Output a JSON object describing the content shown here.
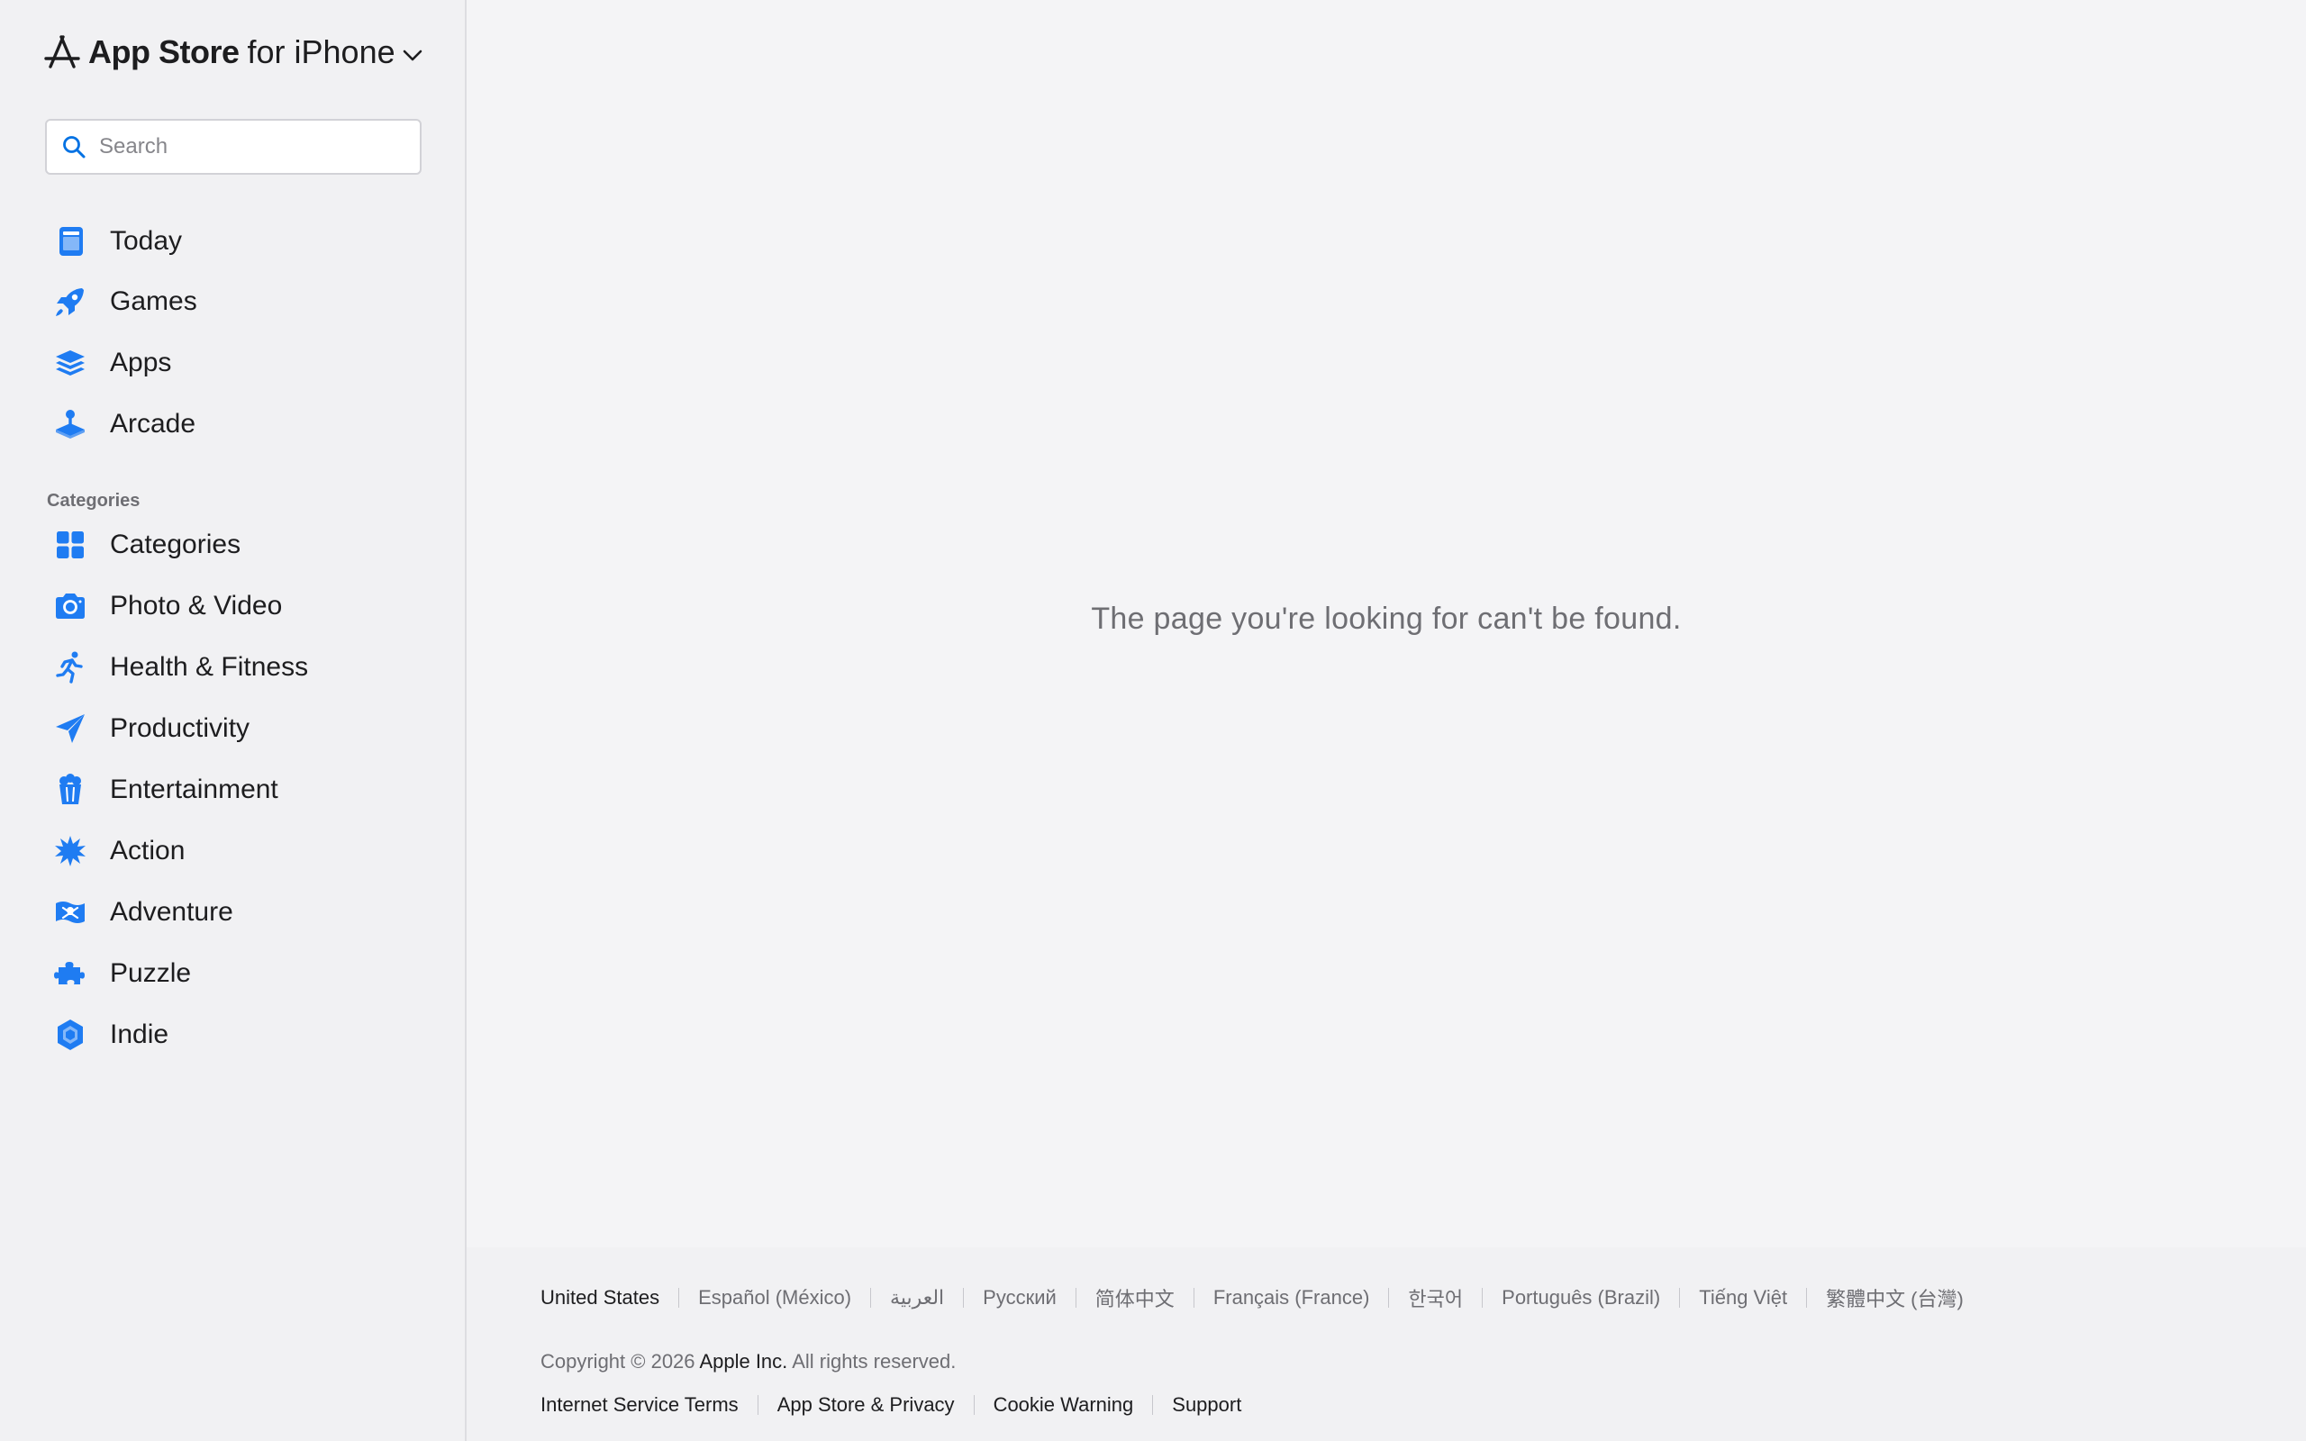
{
  "brand": {
    "app_name": "App Store",
    "platform": "for iPhone"
  },
  "search": {
    "placeholder": "Search"
  },
  "nav": {
    "items": [
      {
        "label": "Today",
        "icon": "today-icon"
      },
      {
        "label": "Games",
        "icon": "rocket-icon"
      },
      {
        "label": "Apps",
        "icon": "layers-icon"
      },
      {
        "label": "Arcade",
        "icon": "joystick-icon"
      }
    ]
  },
  "categories": {
    "header": "Categories",
    "items": [
      {
        "label": "Categories",
        "icon": "grid-icon"
      },
      {
        "label": "Photo & Video",
        "icon": "camera-icon"
      },
      {
        "label": "Health & Fitness",
        "icon": "running-icon"
      },
      {
        "label": "Productivity",
        "icon": "paperplane-icon"
      },
      {
        "label": "Entertainment",
        "icon": "popcorn-icon"
      },
      {
        "label": "Action",
        "icon": "burst-icon"
      },
      {
        "label": "Adventure",
        "icon": "pirate-flag-icon"
      },
      {
        "label": "Puzzle",
        "icon": "puzzle-icon"
      },
      {
        "label": "Indie",
        "icon": "gem-icon"
      }
    ]
  },
  "main": {
    "message": "The page you're looking for can't be found."
  },
  "footer": {
    "languages": [
      "United States",
      "Español (México)",
      "العربية",
      "Русский",
      "简体中文",
      "Français (France)",
      "한국어",
      "Português (Brazil)",
      "Tiếng Việt",
      "繁體中文 (台灣)"
    ],
    "copyright_prefix": "Copyright © 2026",
    "company": "Apple Inc.",
    "rights": "All rights reserved.",
    "links": [
      "Internet Service Terms",
      "App Store & Privacy",
      "Cookie Warning",
      "Support"
    ]
  },
  "colors": {
    "accent": "#0071e3",
    "text": "#1d1d1f",
    "secondary_text": "#6e6e73",
    "sidebar_bg": "#f1f1f3",
    "page_bg": "#f4f4f6"
  }
}
